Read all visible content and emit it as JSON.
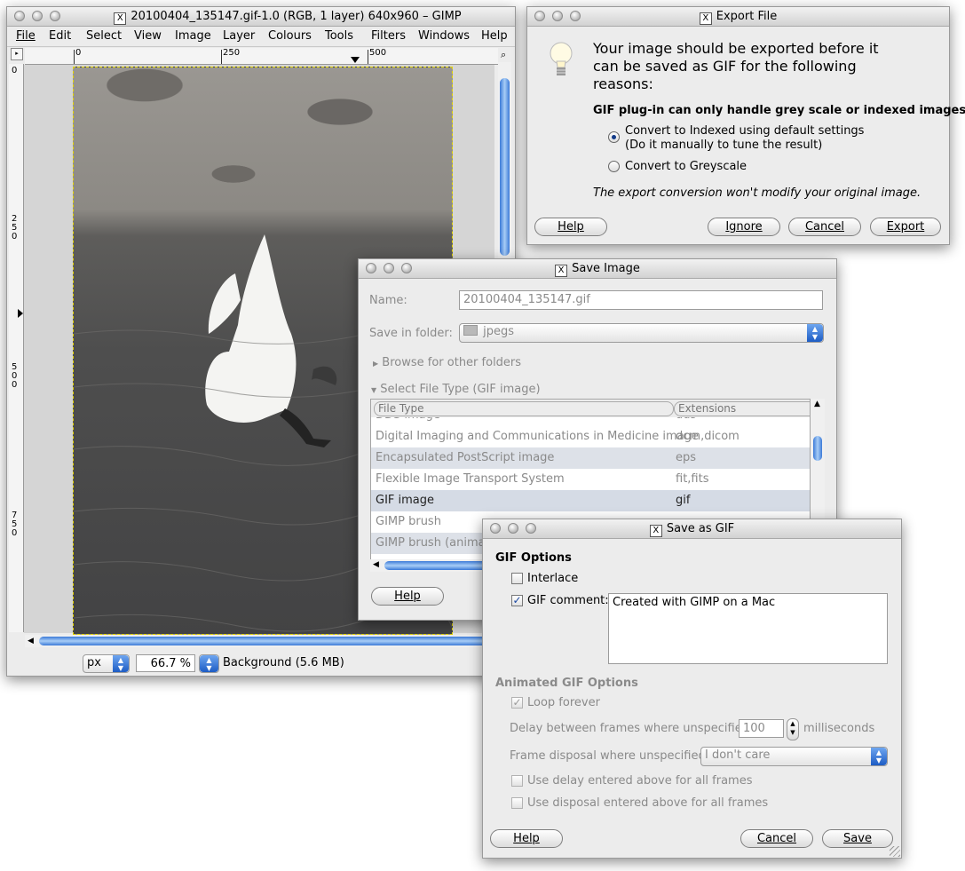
{
  "gimp": {
    "title": "20100404_135147.gif-1.0 (RGB, 1 layer) 640x960 – GIMP",
    "menu": [
      "File",
      "Edit",
      "Select",
      "View",
      "Image",
      "Layer",
      "Colours",
      "Tools",
      "Filters",
      "Windows",
      "Help"
    ],
    "hruler": [
      "0",
      "250",
      "500"
    ],
    "vruler": [
      "0",
      "250",
      "500",
      "750"
    ],
    "unit": "px",
    "zoom": "66.7 %",
    "status": "Background (5.6 MB)"
  },
  "export": {
    "title": "Export File",
    "heading": [
      "Your image should be exported before it",
      "can be saved as GIF for the following",
      "reasons:"
    ],
    "reason": "GIF plug-in can only handle grey scale or indexed images",
    "opt_indexed": "Convert to Indexed using default settings",
    "opt_indexed_sub": "(Do it manually to tune the result)",
    "opt_grey": "Convert to Greyscale",
    "note": "The export conversion won't modify your original image.",
    "btn_help": "Help",
    "btn_ignore": "Ignore",
    "btn_cancel": "Cancel",
    "btn_export": "Export"
  },
  "save": {
    "title": "Save Image",
    "name_label": "Name:",
    "name_value": "20100404_135147.gif",
    "folder_label": "Save in folder:",
    "folder_value": "jpegs",
    "browse": "Browse for other folders",
    "select_type": "Select File Type (GIF image)",
    "col_type": "File Type",
    "col_ext": "Extensions",
    "rows": [
      {
        "type": "DDS image",
        "ext": "dds"
      },
      {
        "type": "Digital Imaging and Communications in Medicine image",
        "ext": "dcm,dicom"
      },
      {
        "type": "Encapsulated PostScript image",
        "ext": "eps"
      },
      {
        "type": "Flexible Image Transport System",
        "ext": "fit,fits"
      },
      {
        "type": "GIF image",
        "ext": "gif"
      },
      {
        "type": "GIMP brush",
        "ext": ""
      },
      {
        "type": "GIMP brush (animated)",
        "ext": ""
      }
    ],
    "btn_help": "Help"
  },
  "gif": {
    "title": "Save as GIF",
    "section1": "GIF Options",
    "interlace": "Interlace",
    "comment_label": "GIF comment:",
    "comment_value": "Created with GIMP on a Mac",
    "section2": "Animated GIF Options",
    "loop": "Loop forever",
    "delay_label": "Delay between frames where unspecified:",
    "delay_value": "100",
    "delay_unit": "milliseconds",
    "disposal_label": "Frame disposal where unspecified:",
    "disposal_value": "I don't care",
    "use_delay": "Use delay entered above for all frames",
    "use_disposal": "Use disposal entered above for all frames",
    "btn_help": "Help",
    "btn_cancel": "Cancel",
    "btn_save": "Save"
  }
}
